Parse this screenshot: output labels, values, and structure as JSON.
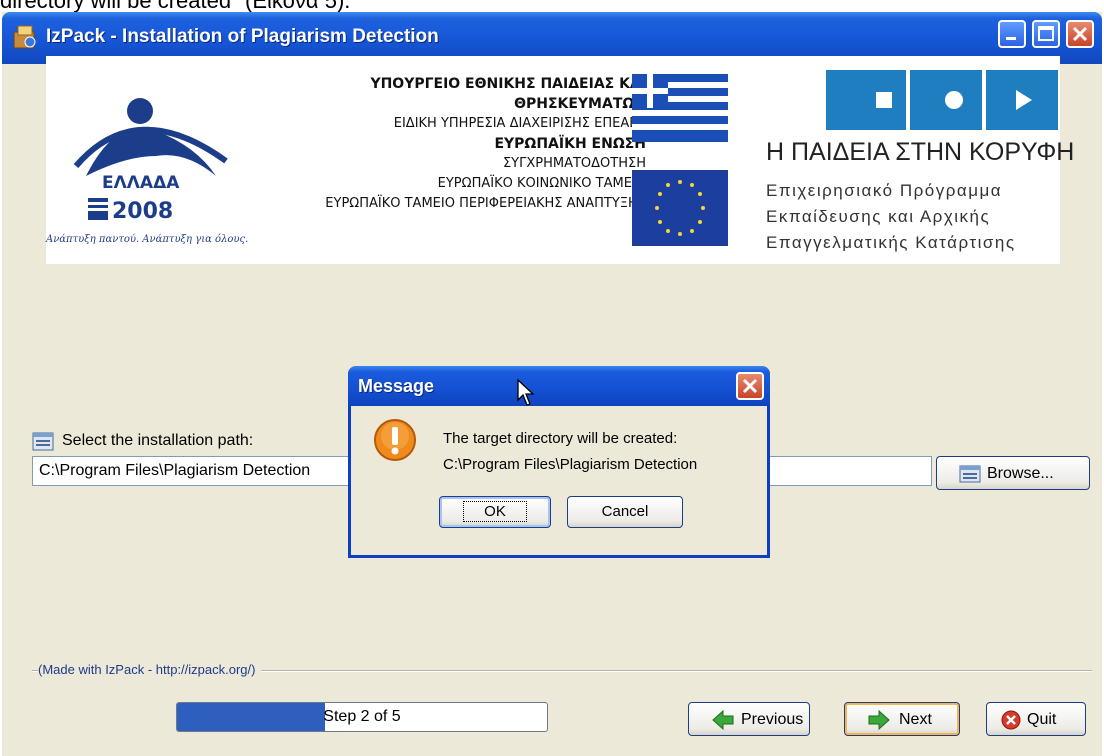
{
  "caption": "directory will be created\" (Εικόνα 5).",
  "window": {
    "title": "IzPack - Installation of Plagiarism Detection"
  },
  "banner": {
    "gr_logo_text": "ΕΛΛΑΔΑ",
    "gr_logo_year": "2008",
    "slogan": "Ανάπτυξη παντού. Ανάπτυξη για όλους.",
    "ministry_lines": [
      "ΥΠΟΥΡΓΕΙΟ ΕΘΝΙΚΗΣ ΠΑΙΔΕΙΑΣ ΚΑΙ ΘΡΗΣΚΕΥΜΑΤΩΝ",
      "ΕΙΔΙΚΗ ΥΠΗΡΕΣΙΑ ΔΙΑΧΕΙΡΙΣΗΣ ΕΠΕΑΕΚ",
      "ΕΥΡΩΠΑΪΚΗ ΕΝΩΣΗ",
      "ΣΥΓΧΡΗΜΑΤΟΔΟΤΗΣΗ",
      "ΕΥΡΩΠΑΪΚΟ ΚΟΙΝΩΝΙΚΟ ΤΑΜΕΙΟ",
      "ΕΥΡΩΠΑΪΚΟ ΤΑΜΕΙΟ ΠΕΡΙΦΕΡΕΙΑΚΗΣ ΑΝΑΠΤΥΞΗΣ"
    ],
    "paideia_title": "Η ΠΑΙΔΕΙΑ ΣΤΗΝ ΚΟΡΥΦΗ",
    "paideia_sub": [
      "Επιχειρησιακό Πρόγραμμα",
      "Εκπαίδευσης και Αρχικής",
      "Επαγγελματικής Κατάρτισης"
    ]
  },
  "path": {
    "label": "Select the installation path:",
    "value": "C:\\Program Files\\Plagiarism Detection",
    "browse_label": "Browse..."
  },
  "footer": {
    "made_with": "(Made with IzPack - http://izpack.org/)",
    "progress_text": "Step 2 of 5",
    "progress_fraction": 0.4,
    "previous_label": "Previous",
    "next_label": "Next",
    "quit_label": "Quit"
  },
  "dialog": {
    "title": "Message",
    "line1": "The target directory will be created:",
    "line2": "C:\\Program Files\\Plagiarism Detection",
    "ok_label": "OK",
    "cancel_label": "Cancel"
  },
  "colors": {
    "titlebar": "#1556d6",
    "panel": "#ece9d8",
    "progress_fill": "#2e5fbf"
  }
}
